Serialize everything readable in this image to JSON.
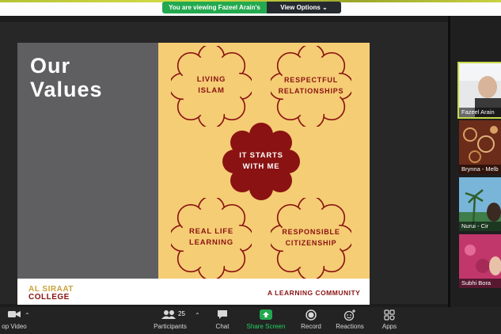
{
  "banner": {
    "viewing_text": "You are viewing Fazeel Arain's screen",
    "options_label": "View Options ⌄"
  },
  "slide": {
    "title_line1": "Our",
    "title_line2": "Values",
    "values": [
      {
        "line1": "LIVING",
        "line2": "ISLAM"
      },
      {
        "line1": "RESPECTFUL",
        "line2": "RELATIONSHIPS"
      },
      {
        "line1": "IT STARTS",
        "line2": "WITH ME"
      },
      {
        "line1": "REAL LIFE",
        "line2": "LEARNING"
      },
      {
        "line1": "RESPONSIBLE",
        "line2": "CITIZENSHIP"
      }
    ],
    "logo_line1": "AL SIRAAT",
    "logo_line2": "COLLEGE",
    "tagline": "A LEARNING COMMUNITY"
  },
  "participants_gallery": [
    {
      "name": "Fazeel Arain"
    },
    {
      "name": "Brynna - Melb"
    },
    {
      "name": "Nurui - Cir"
    },
    {
      "name": "Subhi Bora"
    }
  ],
  "toolbar": {
    "video_label": "op Video",
    "participants_label": "Participants",
    "participants_count": "25",
    "chat_label": "Chat",
    "share_label": "Share Screen",
    "record_label": "Record",
    "reactions_label": "Reactions",
    "apps_label": "Apps"
  },
  "colors": {
    "share_green": "#23a94f",
    "slide_yellow": "#f5cd74",
    "slide_gray": "#5f5e60",
    "maroon": "#8a1212",
    "gold": "#c9a23b"
  }
}
